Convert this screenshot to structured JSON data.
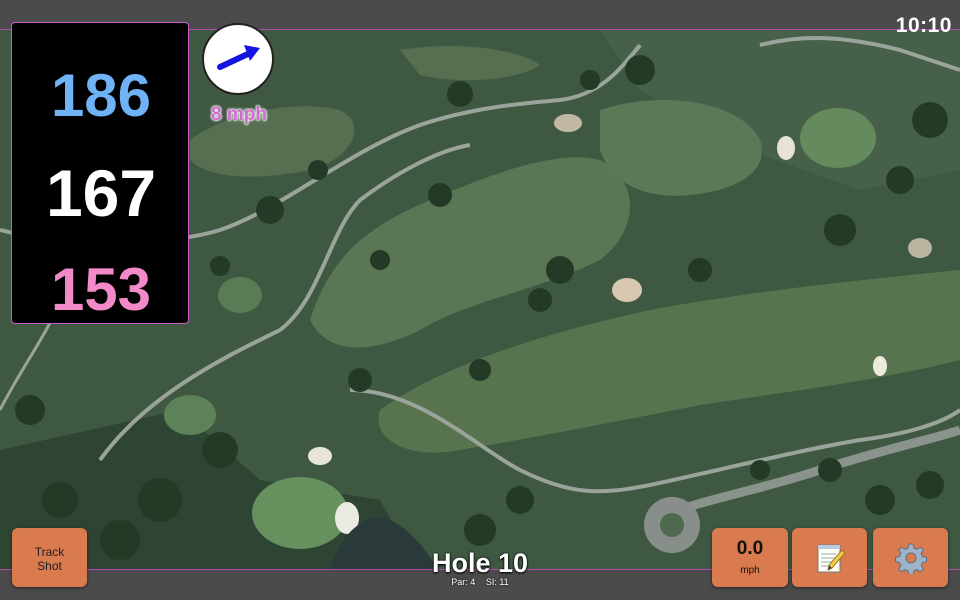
{
  "status": {
    "clock": "10:10"
  },
  "distances": {
    "back": "186",
    "middle": "167",
    "front": "153"
  },
  "wind": {
    "speed_label": "8 mph",
    "direction_icon": "arrow-icon"
  },
  "buttons": {
    "track_shot_line1": "Track",
    "track_shot_line2": "Shot",
    "speed_value": "0.0",
    "speed_unit": "mph",
    "notes_icon": "notepad-icon",
    "settings_icon": "gear-icon"
  },
  "hole": {
    "title": "Hole 10",
    "par": "Par: 4",
    "si": "SI: 11"
  },
  "colors": {
    "back_distance": "#6fb2f5",
    "middle_distance": "#ffffff",
    "front_distance": "#f289c8",
    "button": "#d97b4f",
    "wind_label": "#d06bd0"
  }
}
